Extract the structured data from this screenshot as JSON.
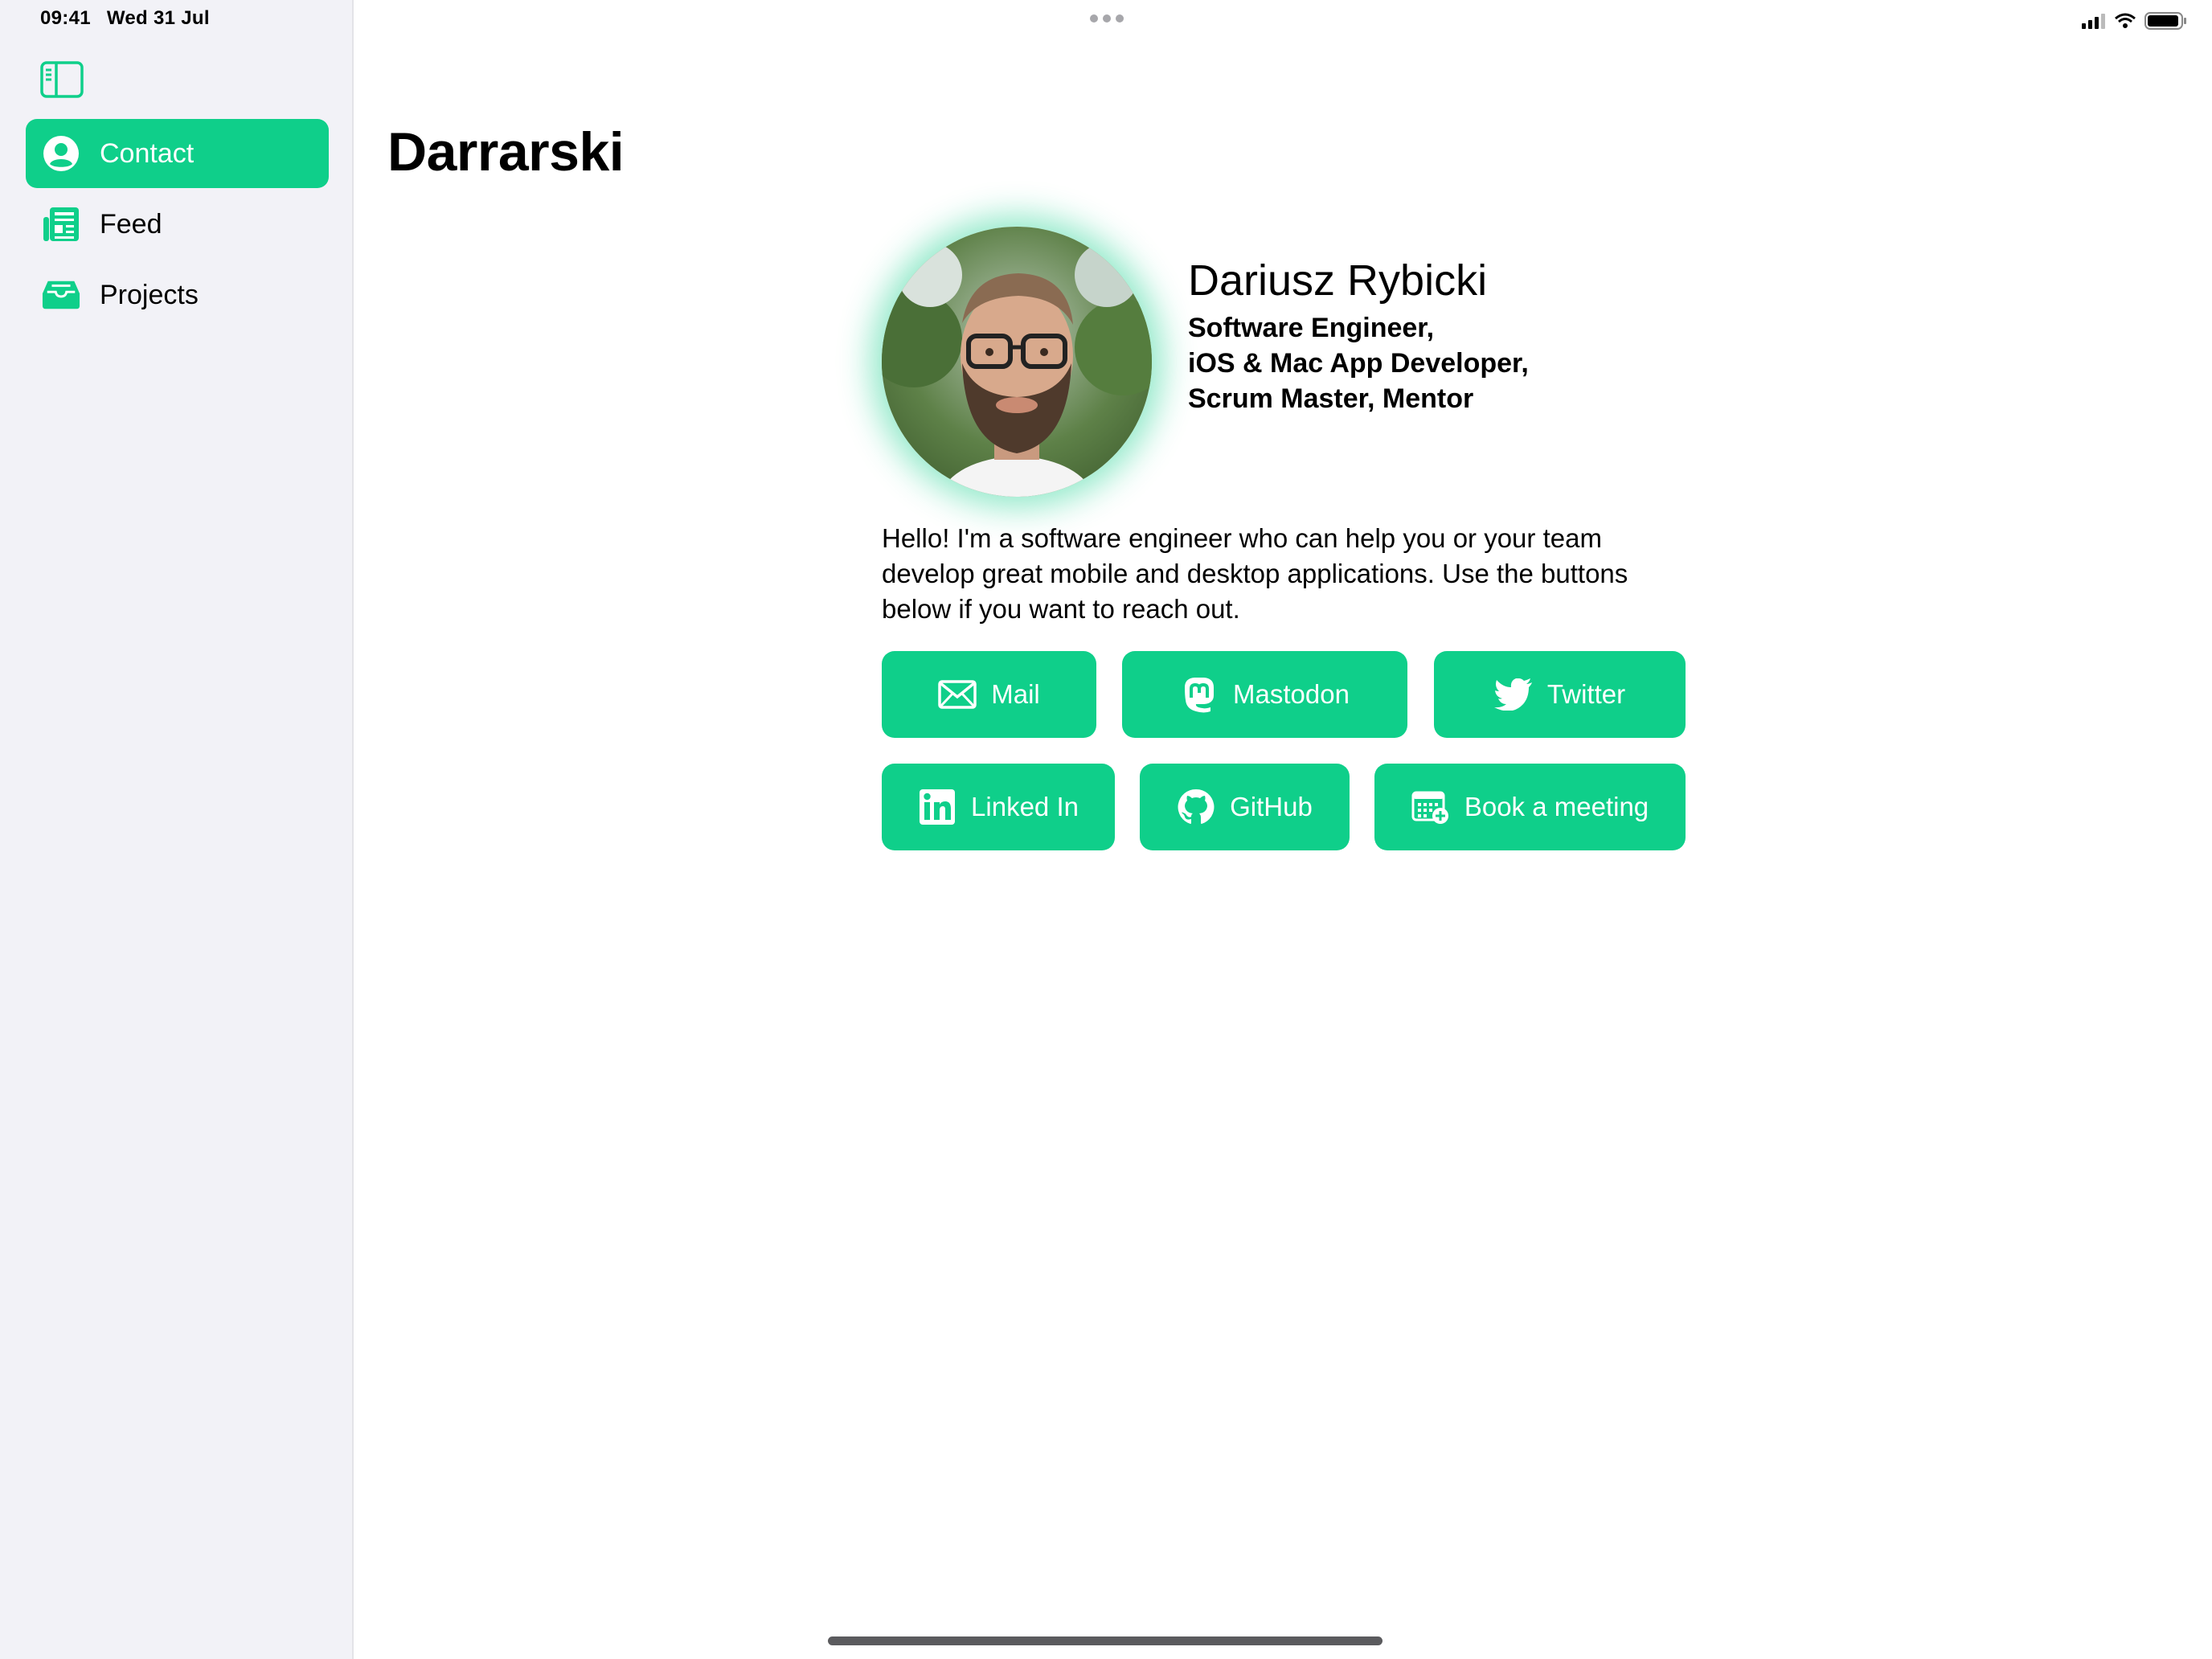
{
  "status_bar": {
    "time": "09:41",
    "date": "Wed 31 Jul"
  },
  "sidebar": {
    "items": [
      {
        "label": "Contact",
        "icon": "person-circle-icon",
        "selected": true
      },
      {
        "label": "Feed",
        "icon": "newspaper-icon",
        "selected": false
      },
      {
        "label": "Projects",
        "icon": "tray-icon",
        "selected": false
      }
    ]
  },
  "main": {
    "title": "Darrarski",
    "profile": {
      "name": "Dariusz Rybicki",
      "roles": [
        "Software Engineer,",
        "iOS & Mac App Developer,",
        "Scrum Master, Mentor"
      ],
      "bio": "Hello! I'm a software engineer who can help you or your team develop great mobile and desktop applications. Use the buttons below if you want to reach out."
    },
    "buttons": [
      {
        "label": "Mail",
        "icon": "envelope-icon"
      },
      {
        "label": "Mastodon",
        "icon": "mastodon-icon"
      },
      {
        "label": "Twitter",
        "icon": "twitter-icon"
      },
      {
        "label": "Linked In",
        "icon": "linkedin-icon"
      },
      {
        "label": "GitHub",
        "icon": "github-icon"
      },
      {
        "label": "Book a meeting",
        "icon": "calendar-plus-icon"
      }
    ]
  },
  "colors": {
    "accent": "#0fcf8a",
    "sidebar_bg": "#f2f2f7"
  }
}
